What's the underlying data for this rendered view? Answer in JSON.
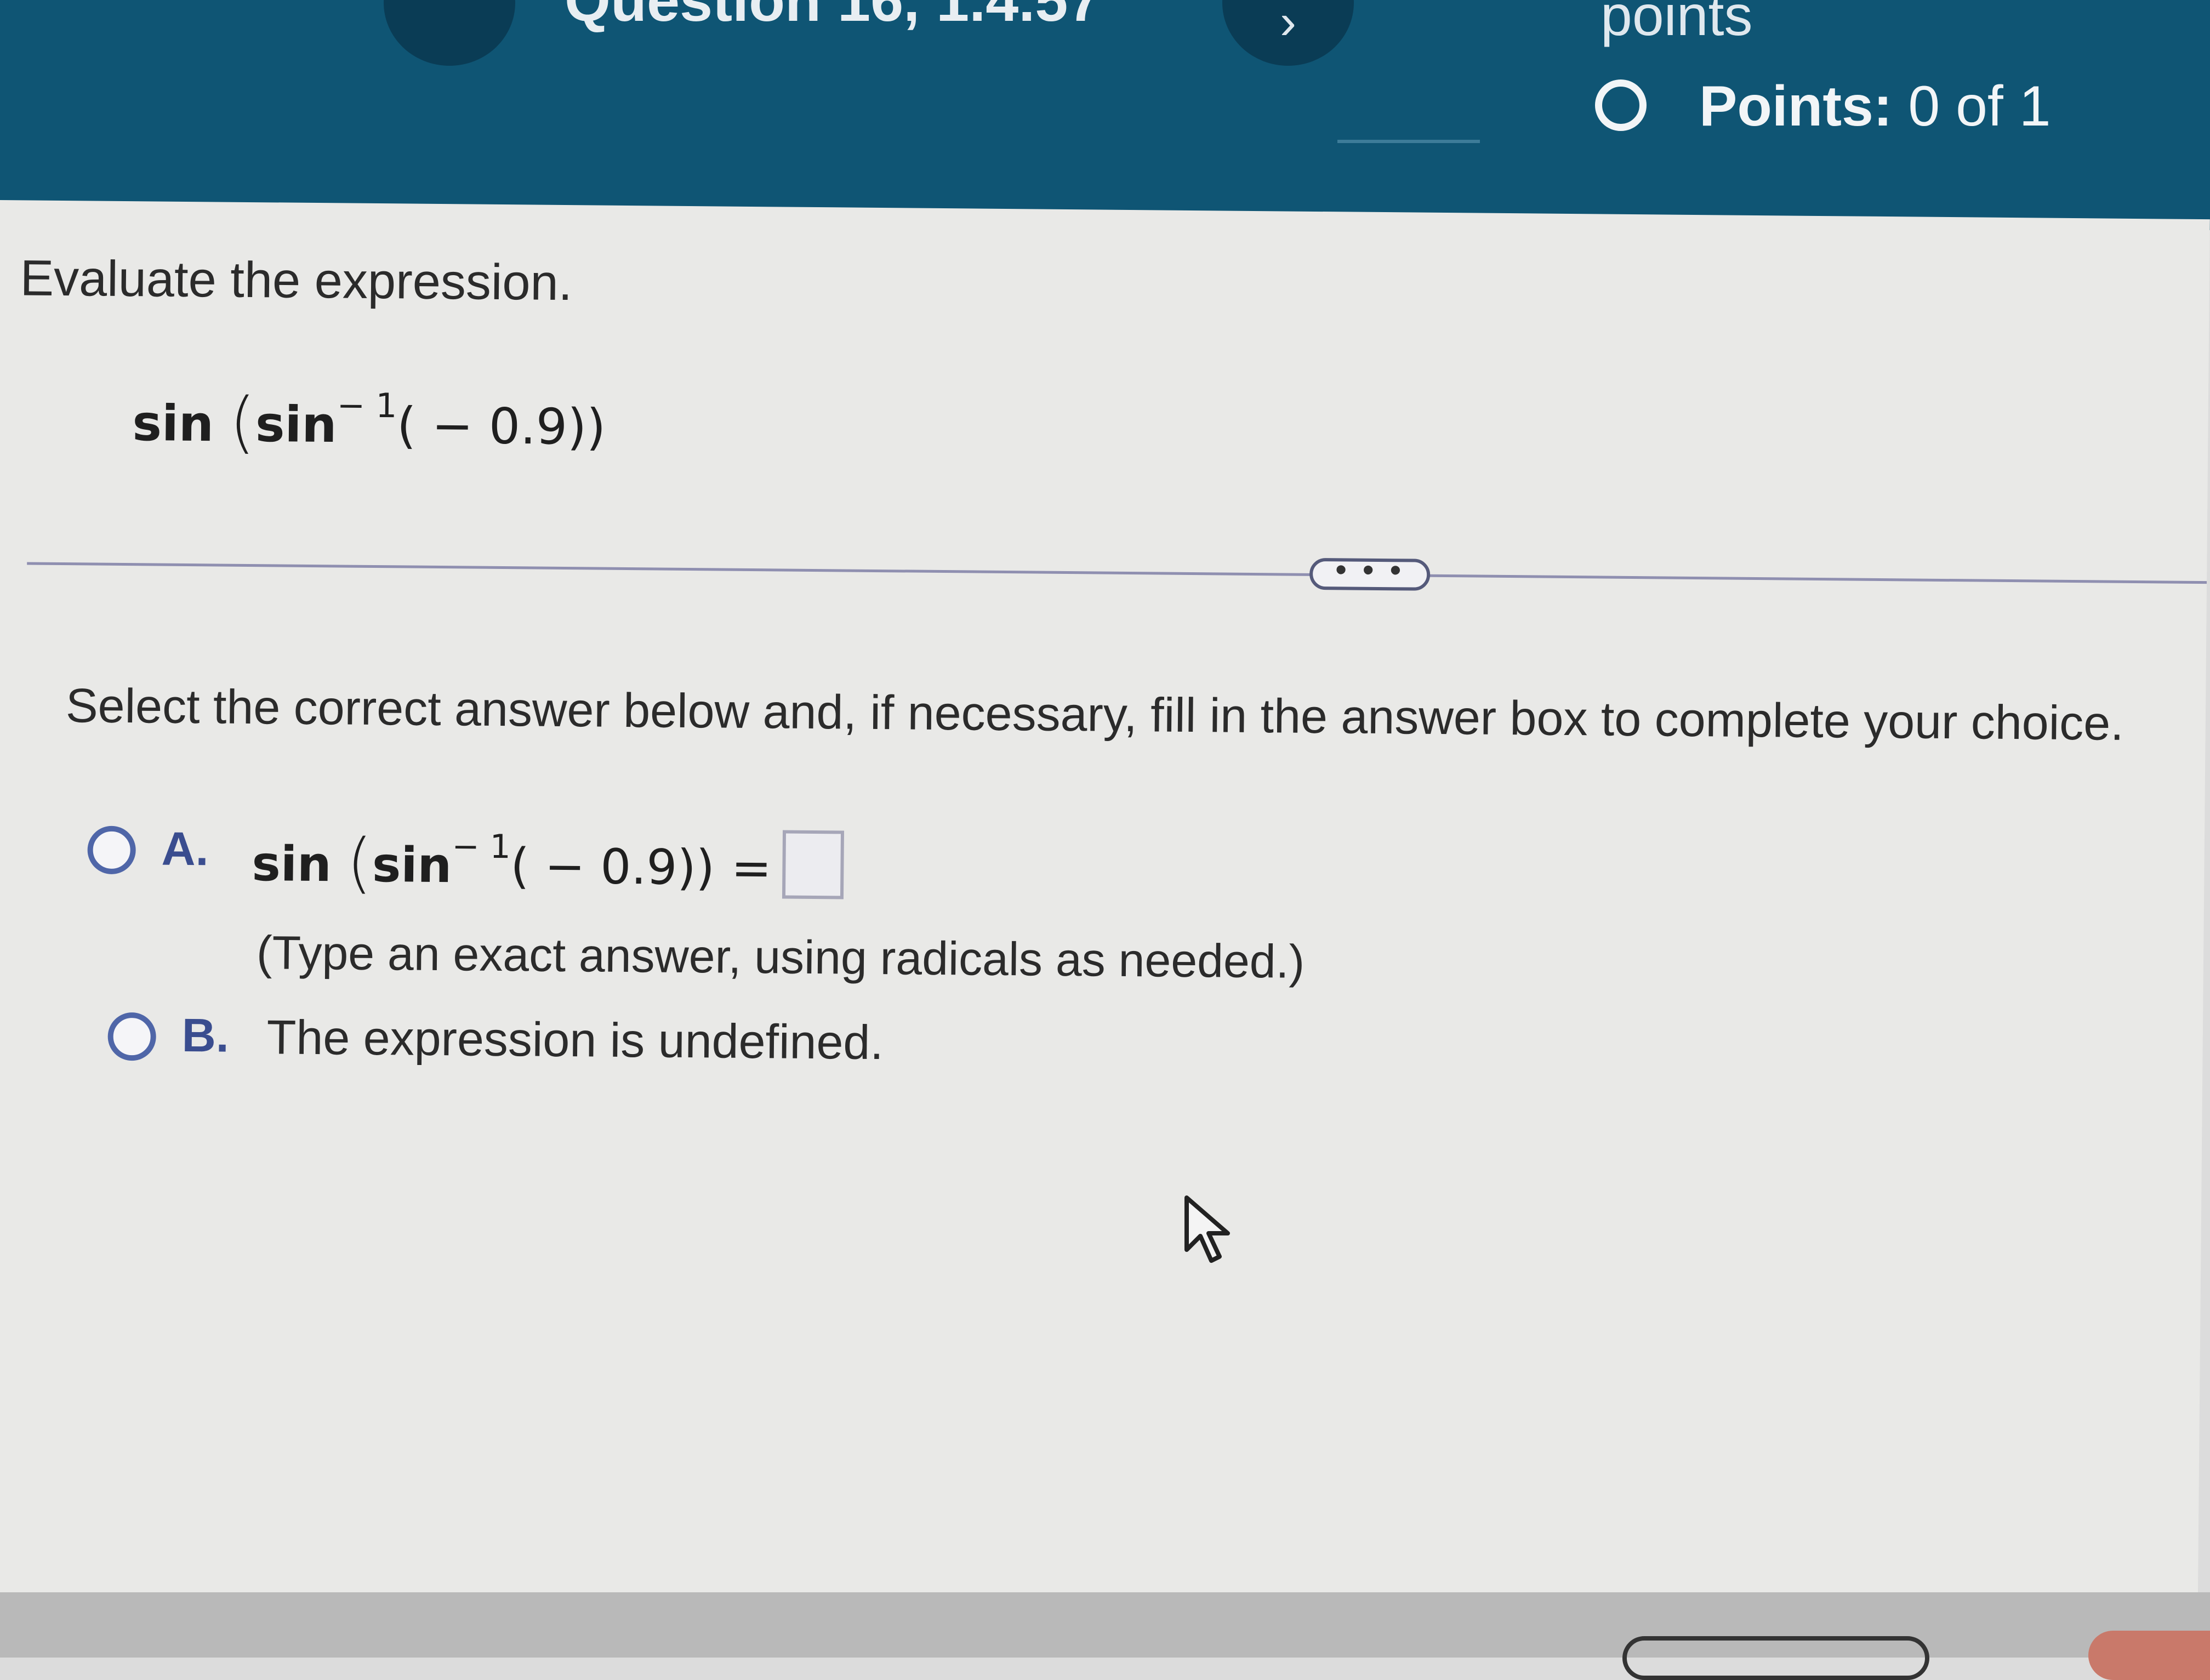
{
  "header": {
    "question_title": "Question 16, 1.4.57",
    "prev_icon": "chevron-left-icon",
    "next_icon": "chevron-right-icon",
    "next_label": "›",
    "points_word": "points",
    "points_label": "Points:",
    "points_value": "0 of 1"
  },
  "question": {
    "prompt": "Evaluate the expression.",
    "expression": {
      "outer_fn": "sin",
      "inner_fn": "sin",
      "inverse_exp": "− 1",
      "argument": "( − 0.9))"
    }
  },
  "more_button": {
    "label": "• • •"
  },
  "answer_section": {
    "instruction": "Select the correct answer below and, if necessary, fill in the answer box to complete your choice.",
    "options": [
      {
        "letter": "A.",
        "expression": {
          "outer_fn": "sin",
          "inner_fn": "sin",
          "inverse_exp": "− 1",
          "argument": "( − 0.9))",
          "equals": "="
        },
        "answer_value": "",
        "hint": "(Type an exact answer, using radicals as needed.)",
        "selected": false
      },
      {
        "letter": "B.",
        "text": "The expression is undefined.",
        "selected": false
      }
    ]
  },
  "colors": {
    "header_bg": "#0f5574",
    "panel_bg": "#e9e9e7",
    "radio_accent": "#4f66a8"
  }
}
